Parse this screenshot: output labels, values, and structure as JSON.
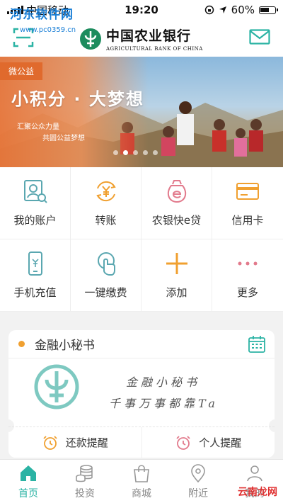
{
  "status_bar": {
    "carrier": "中国移动",
    "time": "19:20",
    "battery": "60%"
  },
  "watermark": {
    "title": "河东软件网",
    "url": "www.pc0359.cn"
  },
  "header": {
    "logo_cn": "中国农业银行",
    "logo_en": "AGRICULTURAL BANK OF CHINA"
  },
  "banner": {
    "tag": "微公益",
    "title": "小积分 · 大梦想",
    "subtitle_line1": "汇聚公众力量",
    "subtitle_line2": "共圆公益梦想",
    "slide_count": 5,
    "active_slide": 1
  },
  "quick_actions": [
    {
      "label": "我的账户",
      "icon": "account-search-icon"
    },
    {
      "label": "转账",
      "icon": "transfer-yuan-icon"
    },
    {
      "label": "农银快e贷",
      "icon": "e-loan-icon"
    },
    {
      "label": "信用卡",
      "icon": "credit-card-icon"
    },
    {
      "label": "手机充值",
      "icon": "phone-topup-icon"
    },
    {
      "label": "一键缴费",
      "icon": "tap-pay-icon"
    },
    {
      "label": "添加",
      "icon": "plus-icon"
    },
    {
      "label": "更多",
      "icon": "more-dots-icon"
    }
  ],
  "secretary": {
    "title": "金融小秘书",
    "handwriting_line1": "金融小秘书",
    "handwriting_line2": "千事万事都靠Ta",
    "repayment_reminder": "还款提醒",
    "personal_reminder": "个人提醒"
  },
  "tab_bar": {
    "items": [
      {
        "label": "首页",
        "active": true
      },
      {
        "label": "投资",
        "active": false
      },
      {
        "label": "商城",
        "active": false
      },
      {
        "label": "附近",
        "active": false
      },
      {
        "label": "我的",
        "active": false
      }
    ]
  },
  "corner_watermark": "云南龙网",
  "colors": {
    "brand_teal": "#2bb3a4",
    "accent_orange": "#f0a030",
    "banner_orange": "#e06a2d"
  }
}
